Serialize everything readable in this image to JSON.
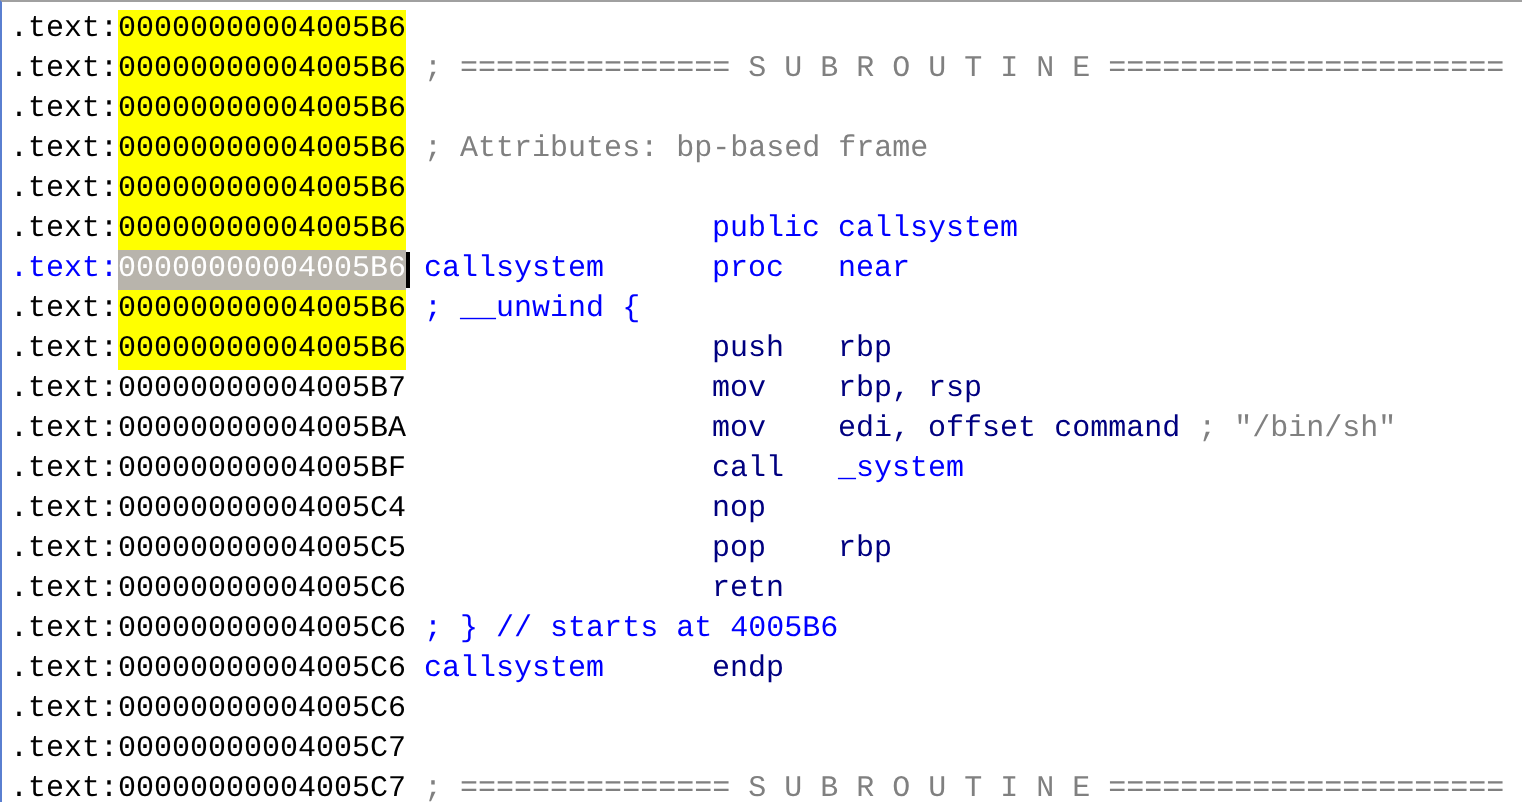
{
  "listing": [
    {
      "segment": ".text:",
      "address": "00000000004005B6",
      "highlighted": true,
      "selected": false
    },
    {
      "segment": ".text:",
      "address": "00000000004005B6",
      "highlighted": true,
      "selected": false,
      "label": {
        "text": "; =============== S U B R O U T I N E ======================",
        "kind": "comment"
      }
    },
    {
      "segment": ".text:",
      "address": "00000000004005B6",
      "highlighted": true,
      "selected": false
    },
    {
      "segment": ".text:",
      "address": "00000000004005B6",
      "highlighted": true,
      "selected": false,
      "label": {
        "text": "; Attributes: bp-based frame",
        "kind": "comment"
      }
    },
    {
      "segment": ".text:",
      "address": "00000000004005B6",
      "highlighted": true,
      "selected": false
    },
    {
      "segment": ".text:",
      "address": "00000000004005B6",
      "highlighted": true,
      "selected": false,
      "mnemonic": {
        "text": "public",
        "kind": "name"
      },
      "operand": {
        "text": "callsystem",
        "kind": "name"
      }
    },
    {
      "segment": ".text:",
      "address": "00000000004005B6",
      "highlighted": false,
      "selected": true,
      "label": {
        "text": "callsystem",
        "kind": "name"
      },
      "mnemonic": {
        "text": "proc",
        "kind": "name"
      },
      "operand": {
        "text": "near",
        "kind": "name"
      }
    },
    {
      "segment": ".text:",
      "address": "00000000004005B6",
      "highlighted": true,
      "selected": false,
      "label": {
        "text": "; __unwind {",
        "kind": "name"
      }
    },
    {
      "segment": ".text:",
      "address": "00000000004005B6",
      "highlighted": true,
      "selected": false,
      "mnemonic": {
        "text": "push",
        "kind": "code"
      },
      "operand": {
        "text": "rbp",
        "kind": "code"
      }
    },
    {
      "segment": ".text:",
      "address": "00000000004005B7",
      "highlighted": false,
      "selected": false,
      "mnemonic": {
        "text": "mov",
        "kind": "code"
      },
      "operand": {
        "text": "rbp, rsp",
        "kind": "code"
      }
    },
    {
      "segment": ".text:",
      "address": "00000000004005BA",
      "highlighted": false,
      "selected": false,
      "mnemonic": {
        "text": "mov",
        "kind": "code"
      },
      "operand": {
        "text": "edi, offset command",
        "kind": "code"
      },
      "comment": {
        "text": "; \"/bin/sh\"",
        "kind": "comment"
      }
    },
    {
      "segment": ".text:",
      "address": "00000000004005BF",
      "highlighted": false,
      "selected": false,
      "mnemonic": {
        "text": "call",
        "kind": "code"
      },
      "operand": {
        "text": "_system",
        "kind": "name"
      }
    },
    {
      "segment": ".text:",
      "address": "00000000004005C4",
      "highlighted": false,
      "selected": false,
      "mnemonic": {
        "text": "nop",
        "kind": "code"
      }
    },
    {
      "segment": ".text:",
      "address": "00000000004005C5",
      "highlighted": false,
      "selected": false,
      "mnemonic": {
        "text": "pop",
        "kind": "code"
      },
      "operand": {
        "text": "rbp",
        "kind": "code"
      }
    },
    {
      "segment": ".text:",
      "address": "00000000004005C6",
      "highlighted": false,
      "selected": false,
      "mnemonic": {
        "text": "retn",
        "kind": "code"
      }
    },
    {
      "segment": ".text:",
      "address": "00000000004005C6",
      "highlighted": false,
      "selected": false,
      "label": {
        "text": "; } // starts at 4005B6",
        "kind": "name"
      }
    },
    {
      "segment": ".text:",
      "address": "00000000004005C6",
      "highlighted": false,
      "selected": false,
      "label": {
        "text": "callsystem",
        "kind": "name"
      },
      "mnemonic": {
        "text": "endp",
        "kind": "code"
      }
    },
    {
      "segment": ".text:",
      "address": "00000000004005C6",
      "highlighted": false,
      "selected": false
    },
    {
      "segment": ".text:",
      "address": "00000000004005C7",
      "highlighted": false,
      "selected": false
    },
    {
      "segment": ".text:",
      "address": "00000000004005C7",
      "highlighted": false,
      "selected": false,
      "label": {
        "text": "; =============== S U B R O U T I N E ======================",
        "kind": "comment"
      }
    }
  ]
}
